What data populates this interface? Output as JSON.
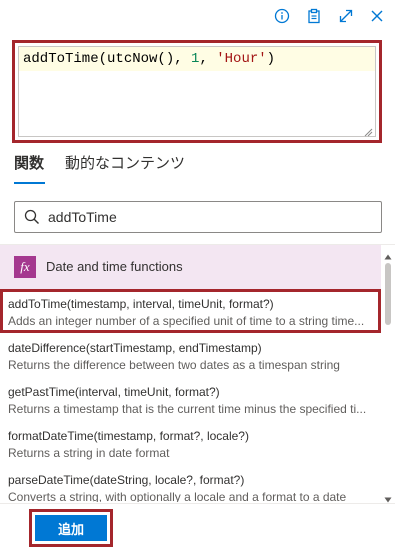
{
  "toolbar": {
    "icons": [
      "info-icon",
      "clipboard-icon",
      "expand-icon",
      "close-icon"
    ]
  },
  "expression": {
    "tokens": [
      {
        "text": "addToTime(utcNow(), ",
        "kind": "fn"
      },
      {
        "text": "1",
        "kind": "num"
      },
      {
        "text": ", ",
        "kind": "fn"
      },
      {
        "text": "'Hour'",
        "kind": "str"
      },
      {
        "text": ")",
        "kind": "fn"
      }
    ]
  },
  "tabs": {
    "functions": "関数",
    "dynamic_content": "動的なコンテンツ"
  },
  "search": {
    "value": "addToTime"
  },
  "category": {
    "badge": "fx",
    "label": "Date and time functions"
  },
  "functions": [
    {
      "signature": "addToTime(timestamp, interval, timeUnit, format?)",
      "description": "Adds an integer number of a specified unit of time to a string time..."
    },
    {
      "signature": "dateDifference(startTimestamp, endTimestamp)",
      "description": "Returns the difference between two dates as a timespan string"
    },
    {
      "signature": "getPastTime(interval, timeUnit, format?)",
      "description": "Returns a timestamp that is the current time minus the specified ti..."
    },
    {
      "signature": "formatDateTime(timestamp, format?, locale?)",
      "description": "Returns a string in date format"
    },
    {
      "signature": "parseDateTime(dateString, locale?, format?)",
      "description": "Converts a string, with optionally a locale and a format to a date"
    }
  ],
  "footer": {
    "add_label": "追加"
  },
  "colors": {
    "accent": "#0078d4",
    "highlight_border": "#a4262c",
    "category_bg": "#f3e6f2",
    "fx_badge": "#a4388f"
  }
}
